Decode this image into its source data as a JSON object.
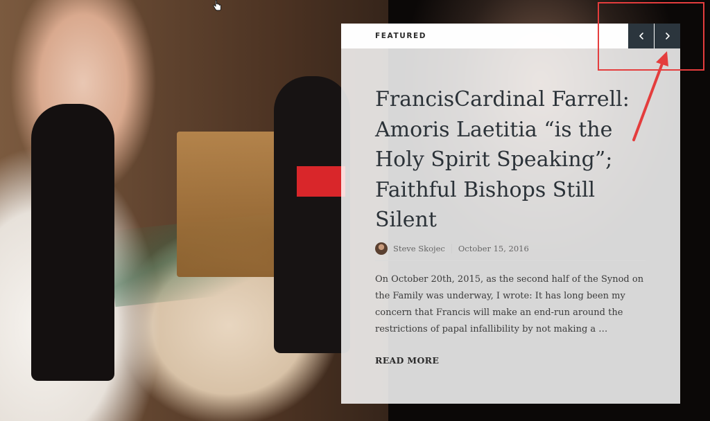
{
  "featured_card": {
    "section_label": "FEATURED",
    "title": "FrancisCardinal Farrell: Amoris Laetitia “is the Holy Spirit Speaking”; Faithful Bishops Still Silent",
    "author": "Steve Skojec",
    "date": "October 15, 2016",
    "excerpt": "On October 20th, 2015, as the second half of the Synod on the Family was underway, I wrote: It has long been my concern that Francis will make an end-run around the restrictions of papal infallibility by not making a …",
    "read_more_label": "READ MORE"
  },
  "navigation": {
    "prev_icon": "chevron-left-icon",
    "next_icon": "chevron-right-icon"
  },
  "annotation": {
    "color": "#e43d3d"
  },
  "theme": {
    "nav_button_bg": "#2b353d",
    "title_color": "#2b3238"
  }
}
